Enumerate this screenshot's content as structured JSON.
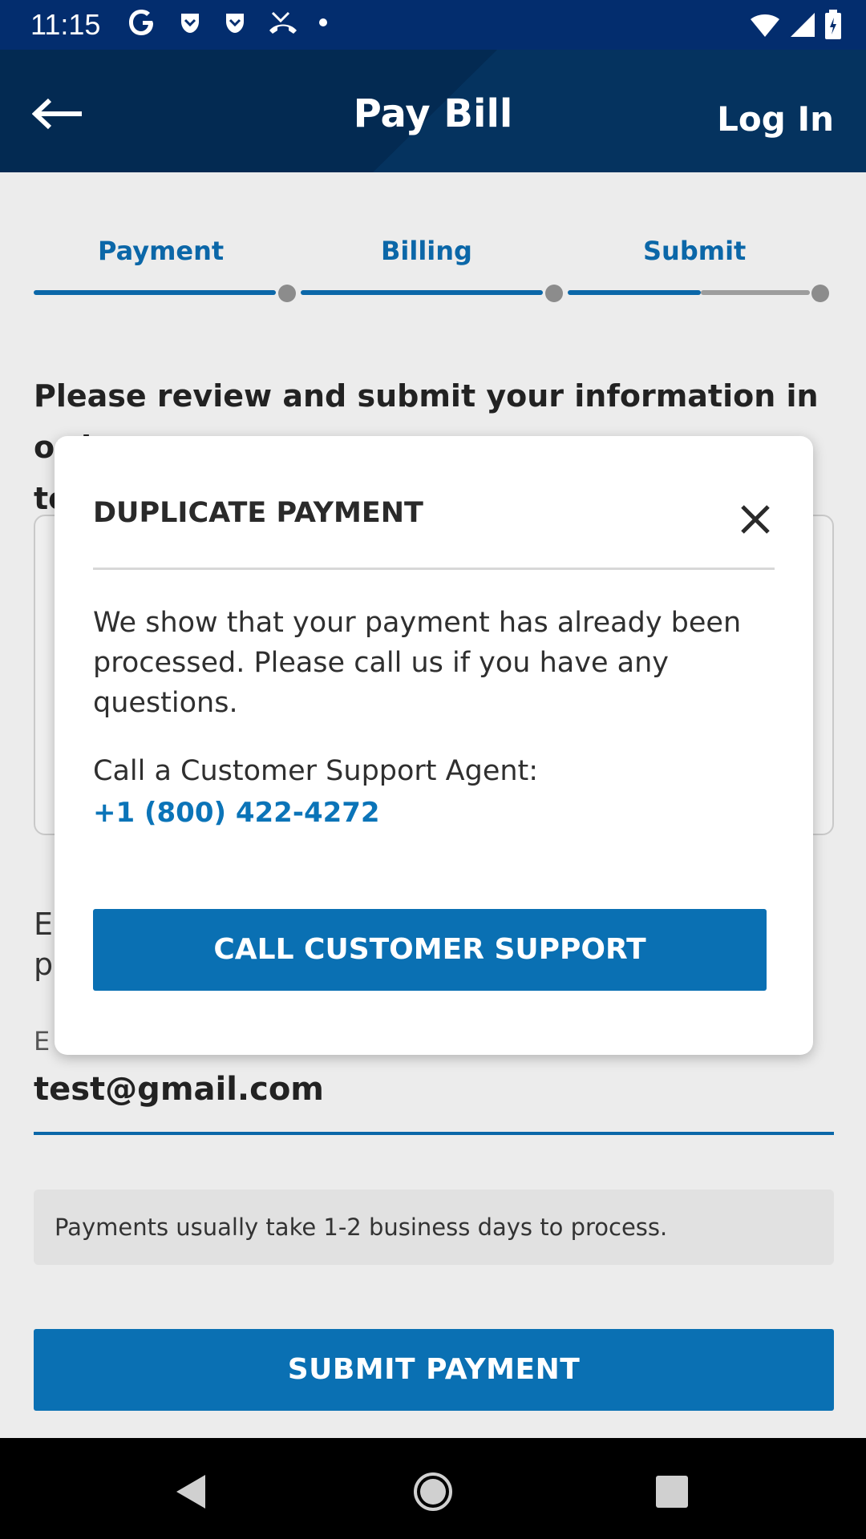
{
  "status_bar": {
    "time": "11:15",
    "icons": [
      "google-icon",
      "pocket-icon",
      "pocket-icon",
      "missed-call-icon",
      "dot-icon"
    ],
    "right_icons": [
      "wifi-icon",
      "signal-icon",
      "battery-icon"
    ]
  },
  "header": {
    "title": "Pay Bill",
    "login_label": "Log In"
  },
  "stepper": {
    "steps": [
      {
        "label": "Payment"
      },
      {
        "label": "Billing"
      },
      {
        "label": "Submit"
      }
    ],
    "active_color": "#0b67a8"
  },
  "page": {
    "intro_line1": "Please review and submit your information in order",
    "intro_line2": "to",
    "side_text_1": "E",
    "side_text_2": "p",
    "email_label": "E",
    "email_value": "test@gmail.com",
    "note": "Payments usually take 1-2 business days to process.",
    "submit_label": "SUBMIT PAYMENT"
  },
  "modal": {
    "title": "DUPLICATE PAYMENT",
    "message": "We show that your payment has already been processed. Please call us if you have any questions.",
    "agent_label": "Call a Customer Support Agent:",
    "phone": "+1 (800) 422-4272",
    "call_button": "CALL CUSTOMER SUPPORT"
  },
  "colors": {
    "brand_dark": "#05335f",
    "accent": "#0a70b3",
    "link": "#0b74b8"
  }
}
